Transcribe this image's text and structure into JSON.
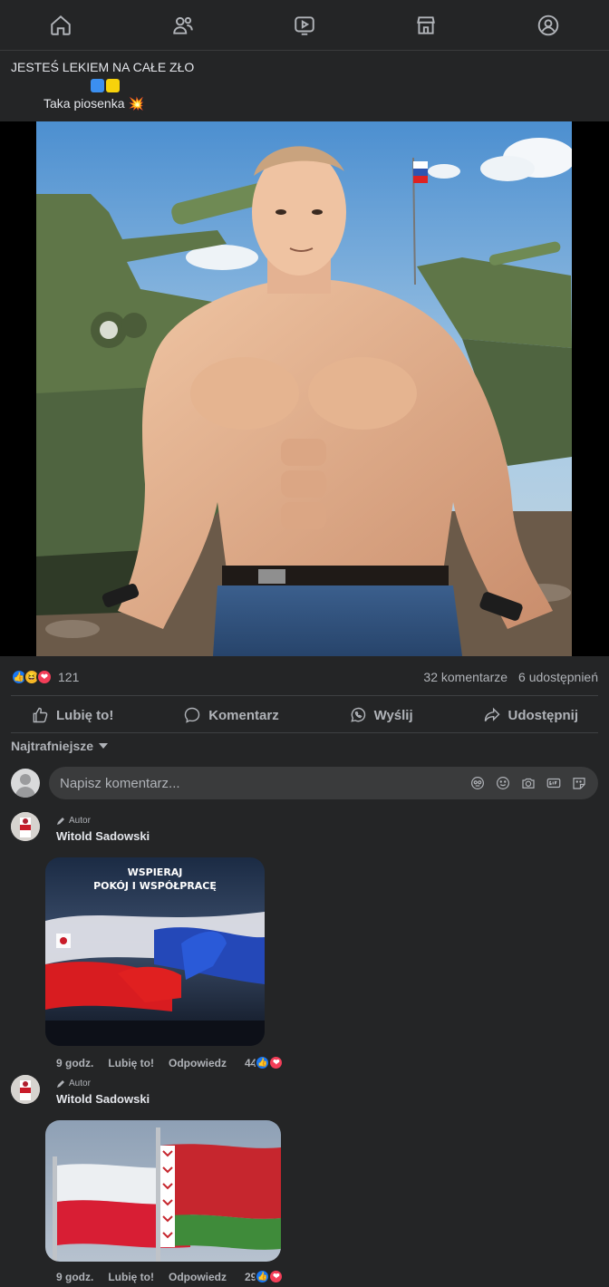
{
  "nav": {
    "items": [
      {
        "name": "home"
      },
      {
        "name": "friends"
      },
      {
        "name": "watch"
      },
      {
        "name": "marketplace"
      },
      {
        "name": "profile"
      }
    ]
  },
  "post": {
    "line1": "JESTEŚ LEKIEM NA CAŁE ZŁO",
    "line3": "Taka piosenka",
    "emoji_flag_colors": [
      "#3b8ff0",
      "#f7d20b"
    ],
    "burst_emoji": "💥"
  },
  "reactions": {
    "count": "121",
    "comments": "32 komentarze",
    "shares": "6 udostępnień"
  },
  "actions": {
    "like": "Lubię to!",
    "comment": "Komentarz",
    "send": "Wyślij",
    "share": "Udostępnij"
  },
  "sort": {
    "label": "Najtrafniejsze"
  },
  "composer": {
    "placeholder": "Napisz komentarz..."
  },
  "comments": [
    {
      "badge": "Autor",
      "name": "Witold Sadowski",
      "image_text_line1": "WSPIERAJ",
      "image_text_line2": "POKÓJ I WSPÓŁPRACĘ",
      "time": "9 godz.",
      "like": "Lubię to!",
      "reply": "Odpowiedz",
      "react_count": "44"
    },
    {
      "badge": "Autor",
      "name": "Witold Sadowski",
      "time": "9 godz.",
      "like": "Lubię to!",
      "reply": "Odpowiedz",
      "react_count": "29"
    }
  ]
}
